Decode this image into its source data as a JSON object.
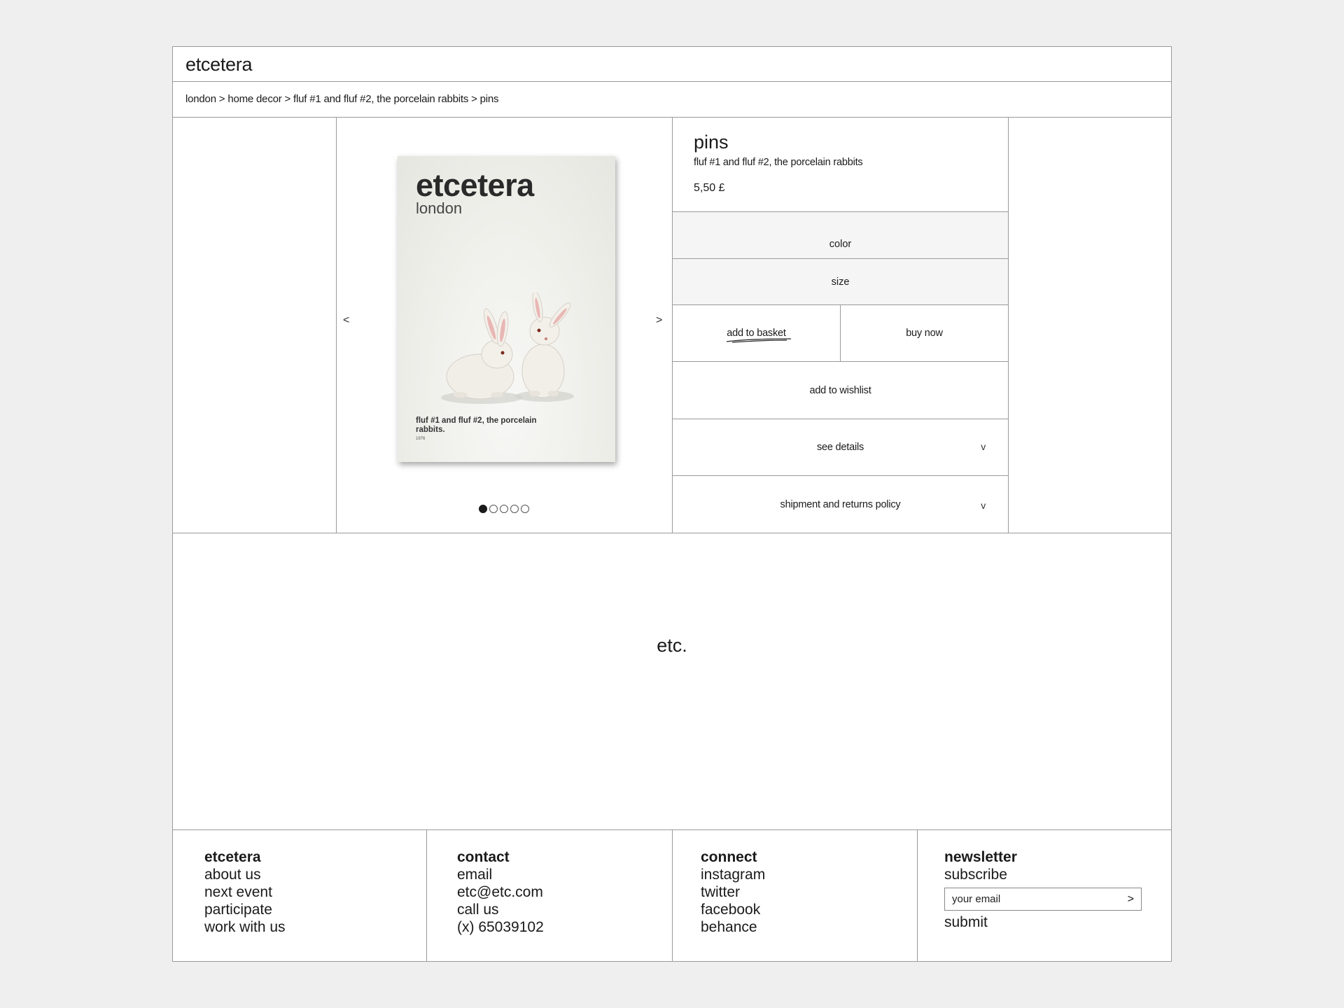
{
  "header": {
    "logo": "etcetera"
  },
  "breadcrumb": "london > home decor > fluf #1 and fluf #2, the porcelain rabbits > pins",
  "gallery": {
    "prev": "<",
    "next": ">",
    "card": {
      "brand": "etcetera",
      "city": "london",
      "caption": "fluf #1 and fluf #2, the porcelain rabbits.",
      "year": "1976"
    },
    "slide_count": 5,
    "active_slide": 1
  },
  "product": {
    "title": "pins",
    "subtitle": "fluf #1 and fluf #2, the porcelain rabbits",
    "price": "5,50 £",
    "color_label": "color",
    "size_label": "size",
    "add_to_basket": "add to basket",
    "buy_now": "buy now",
    "add_to_wishlist": "add to wishlist",
    "see_details": "see details",
    "shipment_policy": "shipment and returns policy",
    "chevron": "v"
  },
  "banner": {
    "text": "etc."
  },
  "footer": {
    "etcetera": {
      "heading": "etcetera",
      "links": [
        "about us",
        "next event",
        "participate",
        "work with us"
      ]
    },
    "contact": {
      "heading": "contact",
      "lines": [
        "email",
        "etc@etc.com",
        "call us",
        "(x) 65039102"
      ]
    },
    "connect": {
      "heading": "connect",
      "links": [
        "instagram",
        "twitter",
        "facebook",
        "behance"
      ]
    },
    "newsletter": {
      "heading": "newsletter",
      "subscribe": "subscribe",
      "email_placeholder": "your email",
      "go": ">",
      "submit": "submit"
    }
  },
  "colors": {
    "background": "#efefef",
    "panel": "#ffffff",
    "border": "#9a9a9a",
    "option_bg": "#f5f5f5",
    "text": "#1a1a1a"
  }
}
